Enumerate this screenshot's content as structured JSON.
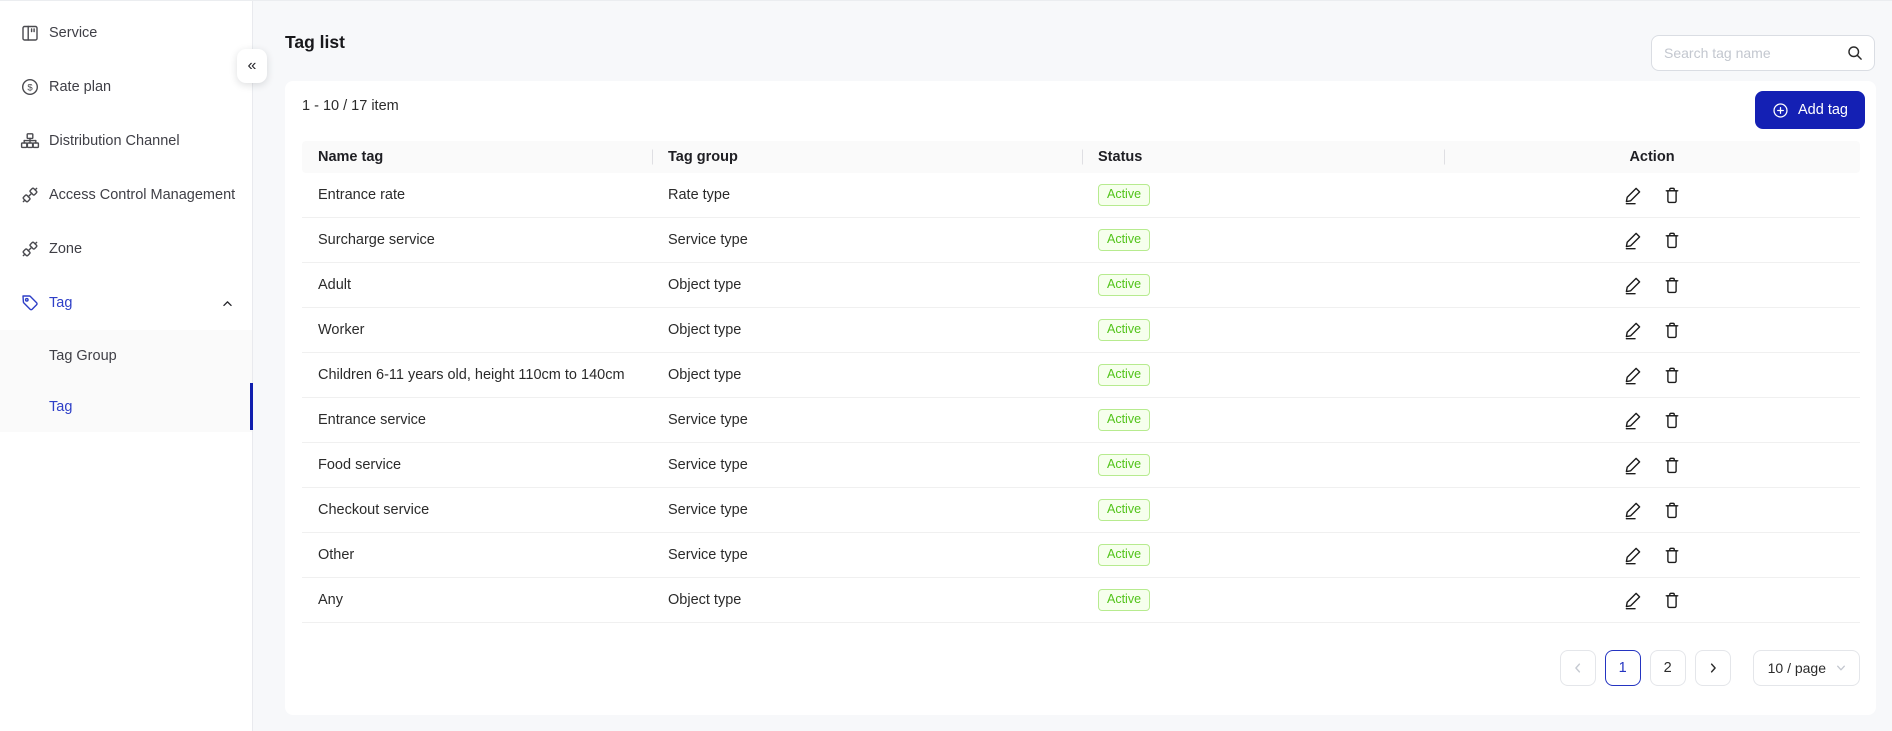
{
  "colors": {
    "primary_button": "#1420b4",
    "active_menu": "#2e3fc7",
    "selected_bar": "#101fae",
    "pagination_active": "#2434c1",
    "status_bg": "#f6ffed",
    "status_border": "#b7eb8f",
    "status_text": "#52c41a"
  },
  "sidebar": {
    "collapse_icon": "«",
    "items": [
      {
        "label": "Service",
        "icon": "service-icon"
      },
      {
        "label": "Rate plan",
        "icon": "dollar-circle-icon"
      },
      {
        "label": "Distribution Channel",
        "icon": "org-chart-icon"
      },
      {
        "label": "Access Control Management",
        "icon": "api-icon"
      },
      {
        "label": "Zone",
        "icon": "api-icon"
      },
      {
        "label": "Tag",
        "icon": "tag-icon",
        "active": true,
        "expanded": true,
        "children": [
          {
            "label": "Tag Group",
            "selected": false
          },
          {
            "label": "Tag",
            "selected": true
          }
        ]
      }
    ]
  },
  "header": {
    "title": "Tag list",
    "search_placeholder": "Search tag name"
  },
  "toolbar": {
    "count_text": "1 - 10 / 17 item",
    "add_button_label": "Add tag"
  },
  "table": {
    "columns": [
      "Name tag",
      "Tag group",
      "Status",
      "Action"
    ],
    "rows": [
      {
        "name": "Entrance rate",
        "group": "Rate type",
        "status": "Active"
      },
      {
        "name": "Surcharge service",
        "group": "Service type",
        "status": "Active"
      },
      {
        "name": "Adult",
        "group": "Object type",
        "status": "Active"
      },
      {
        "name": "Worker",
        "group": "Object type",
        "status": "Active"
      },
      {
        "name": "Children 6-11 years old, height 110cm to 140cm",
        "group": "Object type",
        "status": "Active"
      },
      {
        "name": "Entrance service",
        "group": "Service type",
        "status": "Active"
      },
      {
        "name": "Food service",
        "group": "Service type",
        "status": "Active"
      },
      {
        "name": "Checkout service",
        "group": "Service type",
        "status": "Active"
      },
      {
        "name": "Other",
        "group": "Service type",
        "status": "Active"
      },
      {
        "name": "Any",
        "group": "Object type",
        "status": "Active"
      }
    ]
  },
  "pagination": {
    "pages": [
      "1",
      "2"
    ],
    "current": "1",
    "page_size_label": "10 / page"
  }
}
